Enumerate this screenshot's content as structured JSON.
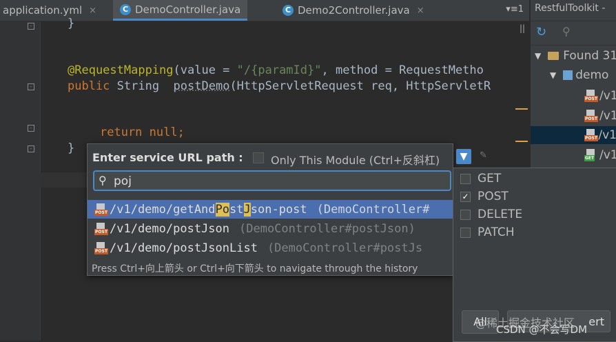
{
  "tabs": [
    {
      "label": "application.yml"
    },
    {
      "label": "DemoController.java"
    },
    {
      "label": "Demo2Controller.java"
    }
  ],
  "tab_close_glyph": "×",
  "tab_menu_label": "▾≡1",
  "editor": {
    "line_brace_close": "}",
    "ann_name": "@RequestMapping",
    "ann_open": "(value = ",
    "ann_value": "\"/{paramId}\"",
    "ann_method": ", method = RequestMetho",
    "kw_public": "public",
    "sig_type": " String  ",
    "fn_name": "postDemo",
    "sig_params": "(HttpServletRequest req, HttpServletR",
    "kw_return": "return",
    "return_val": " null;",
    "class_brace": "}"
  },
  "toolwindow": {
    "title": "RestfulToolkit - ",
    "found_label": "Found 31",
    "module_label": "demo",
    "endpoints": [
      {
        "method": "POST",
        "path": "/v1"
      },
      {
        "method": "POST",
        "path": "/v1"
      },
      {
        "method": "POST",
        "path": "/v1",
        "selected": true
      },
      {
        "method": "GET",
        "path": "/v1"
      }
    ]
  },
  "popup": {
    "prompt": "Enter service URL path :",
    "only_module_label": "Only This Module (Ctrl+反斜杠)",
    "search_value": "poj",
    "results": [
      {
        "p1": "/v1/demo/getAnd",
        "h1": "Po",
        "p2": "st",
        "h2": "J",
        "p3": "son-post",
        "controller": "(DemoController#",
        "selected": true
      },
      {
        "p1": "/v1/demo/postJson",
        "h1": "",
        "p2": "",
        "h2": "",
        "p3": "",
        "controller": "(DemoController#postJson)",
        "selected": false
      },
      {
        "p1": "/v1/demo/postJsonList",
        "h1": "",
        "p2": "",
        "h2": "",
        "p3": "",
        "controller": "(DemoController#postJs",
        "selected": false
      }
    ],
    "hint": "Press Ctrl+向上箭头 or Ctrl+向下箭头 to navigate through the history"
  },
  "method_filter": {
    "items": [
      {
        "label": "GET",
        "checked": false
      },
      {
        "label": "POST",
        "checked": true
      },
      {
        "label": "DELETE",
        "checked": false
      },
      {
        "label": "PATCH",
        "checked": false
      }
    ],
    "all_label": "All",
    "revert_label": "ert"
  },
  "watermark": {
    "line1": "@稀土掘金技术社区",
    "line2": "CSDN @不会写DM"
  },
  "colors": {
    "accent": "#4a88c7",
    "selection": "#4b6eaf",
    "post_tag": "#c25a29",
    "get_tag": "#3c9d44",
    "match_highlight": "#dcbf56"
  }
}
